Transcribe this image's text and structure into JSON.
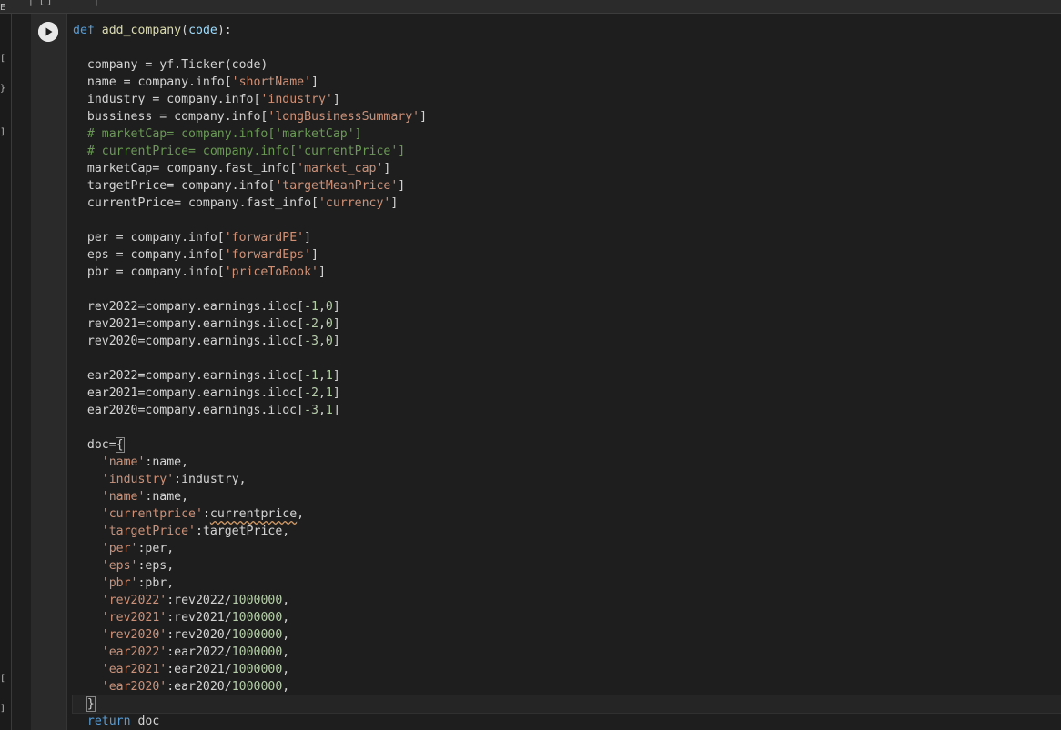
{
  "window": {
    "top_fragments": [
      "|",
      "[ ]",
      "|"
    ]
  },
  "left_rail": {
    "glyphs": [
      "E",
      "[",
      "}",
      "]",
      "[",
      "]"
    ]
  },
  "cell": {
    "run_button_icon": "play-icon",
    "code_lines": [
      [
        {
          "t": "def ",
          "c": "kw"
        },
        {
          "t": "add_company",
          "c": "fn"
        },
        {
          "t": "(",
          "c": ""
        },
        {
          "t": "code",
          "c": "param"
        },
        {
          "t": "):",
          "c": ""
        }
      ],
      [],
      [
        {
          "t": "  company = yf.Ticker(code)",
          "c": ""
        }
      ],
      [
        {
          "t": "  name = company.info[",
          "c": ""
        },
        {
          "t": "'shortName'",
          "c": "str"
        },
        {
          "t": "]",
          "c": ""
        }
      ],
      [
        {
          "t": "  industry = company.info[",
          "c": ""
        },
        {
          "t": "'industry'",
          "c": "str"
        },
        {
          "t": "]",
          "c": ""
        }
      ],
      [
        {
          "t": "  bussiness = company.info[",
          "c": ""
        },
        {
          "t": "'longBusinessSummary'",
          "c": "str"
        },
        {
          "t": "]",
          "c": ""
        }
      ],
      [
        {
          "t": "  # marketCap= company.info['marketCap']",
          "c": "cmt"
        }
      ],
      [
        {
          "t": "  # currentPrice= company.info['currentPrice']",
          "c": "cmt"
        }
      ],
      [
        {
          "t": "  marketCap= company.fast_info[",
          "c": ""
        },
        {
          "t": "'market_cap'",
          "c": "str"
        },
        {
          "t": "]",
          "c": ""
        }
      ],
      [
        {
          "t": "  targetPrice= company.info[",
          "c": ""
        },
        {
          "t": "'targetMeanPrice'",
          "c": "str"
        },
        {
          "t": "]",
          "c": ""
        }
      ],
      [
        {
          "t": "  currentPrice= company.fast_info[",
          "c": ""
        },
        {
          "t": "'currency'",
          "c": "str"
        },
        {
          "t": "]",
          "c": ""
        }
      ],
      [],
      [
        {
          "t": "  per = company.info[",
          "c": ""
        },
        {
          "t": "'forwardPE'",
          "c": "str"
        },
        {
          "t": "]",
          "c": ""
        }
      ],
      [
        {
          "t": "  eps = company.info[",
          "c": ""
        },
        {
          "t": "'forwardEps'",
          "c": "str"
        },
        {
          "t": "]",
          "c": ""
        }
      ],
      [
        {
          "t": "  pbr = company.info[",
          "c": ""
        },
        {
          "t": "'priceToBook'",
          "c": "str"
        },
        {
          "t": "]",
          "c": ""
        }
      ],
      [],
      [
        {
          "t": "  rev2022=company.earnings.iloc[",
          "c": ""
        },
        {
          "t": "-1",
          "c": "num"
        },
        {
          "t": ",",
          "c": ""
        },
        {
          "t": "0",
          "c": "num"
        },
        {
          "t": "]",
          "c": ""
        }
      ],
      [
        {
          "t": "  rev2021=company.earnings.iloc[",
          "c": ""
        },
        {
          "t": "-2",
          "c": "num"
        },
        {
          "t": ",",
          "c": ""
        },
        {
          "t": "0",
          "c": "num"
        },
        {
          "t": "]",
          "c": ""
        }
      ],
      [
        {
          "t": "  rev2020=company.earnings.iloc[",
          "c": ""
        },
        {
          "t": "-3",
          "c": "num"
        },
        {
          "t": ",",
          "c": ""
        },
        {
          "t": "0",
          "c": "num"
        },
        {
          "t": "]",
          "c": ""
        }
      ],
      [],
      [
        {
          "t": "  ear2022=company.earnings.iloc[",
          "c": ""
        },
        {
          "t": "-1",
          "c": "num"
        },
        {
          "t": ",",
          "c": ""
        },
        {
          "t": "1",
          "c": "num"
        },
        {
          "t": "]",
          "c": ""
        }
      ],
      [
        {
          "t": "  ear2021=company.earnings.iloc[",
          "c": ""
        },
        {
          "t": "-2",
          "c": "num"
        },
        {
          "t": ",",
          "c": ""
        },
        {
          "t": "1",
          "c": "num"
        },
        {
          "t": "]",
          "c": ""
        }
      ],
      [
        {
          "t": "  ear2020=company.earnings.iloc[",
          "c": ""
        },
        {
          "t": "-3",
          "c": "num"
        },
        {
          "t": ",",
          "c": ""
        },
        {
          "t": "1",
          "c": "num"
        },
        {
          "t": "]",
          "c": ""
        }
      ],
      [],
      [
        {
          "t": "  doc=",
          "c": ""
        },
        {
          "t": "{",
          "c": "bracket"
        }
      ],
      [
        {
          "t": "    ",
          "c": ""
        },
        {
          "t": "'name'",
          "c": "str"
        },
        {
          "t": ":name,",
          "c": ""
        }
      ],
      [
        {
          "t": "    ",
          "c": ""
        },
        {
          "t": "'industry'",
          "c": "str"
        },
        {
          "t": ":industry,",
          "c": ""
        }
      ],
      [
        {
          "t": "    ",
          "c": ""
        },
        {
          "t": "'name'",
          "c": "str"
        },
        {
          "t": ":name,",
          "c": ""
        }
      ],
      [
        {
          "t": "    ",
          "c": ""
        },
        {
          "t": "'currentprice'",
          "c": "str"
        },
        {
          "t": ":",
          "c": ""
        },
        {
          "t": "currentprice",
          "c": "squiggle"
        },
        {
          "t": ",",
          "c": ""
        }
      ],
      [
        {
          "t": "    ",
          "c": ""
        },
        {
          "t": "'targetPrice'",
          "c": "str"
        },
        {
          "t": ":targetPrice,",
          "c": ""
        }
      ],
      [
        {
          "t": "    ",
          "c": ""
        },
        {
          "t": "'per'",
          "c": "str"
        },
        {
          "t": ":per,",
          "c": ""
        }
      ],
      [
        {
          "t": "    ",
          "c": ""
        },
        {
          "t": "'eps'",
          "c": "str"
        },
        {
          "t": ":eps,",
          "c": ""
        }
      ],
      [
        {
          "t": "    ",
          "c": ""
        },
        {
          "t": "'pbr'",
          "c": "str"
        },
        {
          "t": ":pbr,",
          "c": ""
        }
      ],
      [
        {
          "t": "    ",
          "c": ""
        },
        {
          "t": "'rev2022'",
          "c": "str"
        },
        {
          "t": ":rev2022/",
          "c": ""
        },
        {
          "t": "1000000",
          "c": "num"
        },
        {
          "t": ",",
          "c": ""
        }
      ],
      [
        {
          "t": "    ",
          "c": ""
        },
        {
          "t": "'rev2021'",
          "c": "str"
        },
        {
          "t": ":rev2021/",
          "c": ""
        },
        {
          "t": "1000000",
          "c": "num"
        },
        {
          "t": ",",
          "c": ""
        }
      ],
      [
        {
          "t": "    ",
          "c": ""
        },
        {
          "t": "'rev2020'",
          "c": "str"
        },
        {
          "t": ":rev2020/",
          "c": ""
        },
        {
          "t": "1000000",
          "c": "num"
        },
        {
          "t": ",",
          "c": ""
        }
      ],
      [
        {
          "t": "    ",
          "c": ""
        },
        {
          "t": "'ear2022'",
          "c": "str"
        },
        {
          "t": ":ear2022/",
          "c": ""
        },
        {
          "t": "1000000",
          "c": "num"
        },
        {
          "t": ",",
          "c": ""
        }
      ],
      [
        {
          "t": "    ",
          "c": ""
        },
        {
          "t": "'ear2021'",
          "c": "str"
        },
        {
          "t": ":ear2021/",
          "c": ""
        },
        {
          "t": "1000000",
          "c": "num"
        },
        {
          "t": ",",
          "c": ""
        }
      ],
      [
        {
          "t": "    ",
          "c": ""
        },
        {
          "t": "'ear2020'",
          "c": "str"
        },
        {
          "t": ":ear2020/",
          "c": ""
        },
        {
          "t": "1000000",
          "c": "num"
        },
        {
          "t": ",",
          "c": ""
        }
      ],
      [
        {
          "t": "  ",
          "c": ""
        },
        {
          "t": "}",
          "c": "bracket"
        }
      ],
      [
        {
          "t": "  ",
          "c": ""
        },
        {
          "t": "return ",
          "c": "kw"
        },
        {
          "t": "doc",
          "c": ""
        }
      ]
    ],
    "active_line_index": 39
  }
}
